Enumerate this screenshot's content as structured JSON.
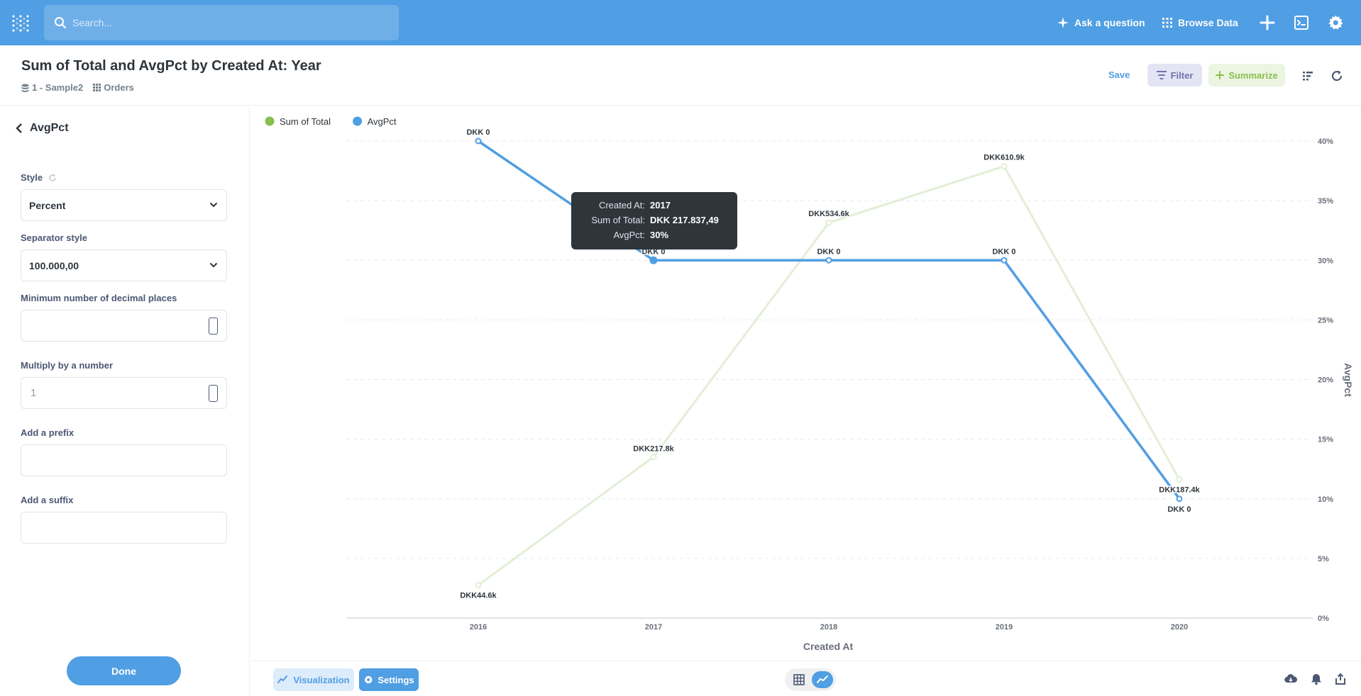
{
  "nav": {
    "search_placeholder": "Search...",
    "ask_label": "Ask a question",
    "browse_label": "Browse Data"
  },
  "header": {
    "title": "Sum of Total and AvgPct by Created At: Year",
    "database": "1 - Sample2",
    "table": "Orders",
    "save_label": "Save",
    "filter_label": "Filter",
    "summarize_label": "Summarize"
  },
  "sidebar": {
    "back_label": "AvgPct",
    "style_label": "Style",
    "style_value": "Percent",
    "separator_label": "Separator style",
    "separator_value": "100.000,00",
    "decimals_label": "Minimum number of decimal places",
    "decimals_value": "",
    "multiply_label": "Multiply by a number",
    "multiply_placeholder": "1",
    "prefix_label": "Add a prefix",
    "suffix_label": "Add a suffix",
    "done_label": "Done"
  },
  "tooltip": {
    "rows": [
      {
        "key": "Created At:",
        "value": "2017"
      },
      {
        "key": "Sum of Total:",
        "value": "DKK 217.837,49"
      },
      {
        "key": "AvgPct:",
        "value": "30%"
      }
    ]
  },
  "footer": {
    "visualization_label": "Visualization",
    "settings_label": "Settings"
  },
  "colors": {
    "brand": "#509ee3",
    "sum_of_total": "#88bf4d",
    "avgpct": "#509ee3"
  },
  "chart_data": {
    "type": "line",
    "categories": [
      "2016",
      "2017",
      "2018",
      "2019",
      "2020"
    ],
    "series": [
      {
        "name": "Sum of Total",
        "values": [
          44600,
          217800,
          534600,
          610900,
          187400
        ],
        "labels": [
          "DKK44.6k",
          "DKK217.8k",
          "DKK534.6k",
          "DKK610.9k",
          "DKK187.4k"
        ],
        "color": "#88bf4d",
        "dimmed": true
      },
      {
        "name": "AvgPct",
        "values": [
          40,
          30,
          30,
          30,
          10
        ],
        "labels": [
          "DKK 0",
          "DKK 0",
          "DKK 0",
          "DKK 0",
          "DKK 0"
        ],
        "color": "#509ee3"
      }
    ],
    "xlabel": "Created At",
    "ylabel_right": "AvgPct",
    "y_right_ticks": [
      "0%",
      "5%",
      "10%",
      "15%",
      "20%",
      "25%",
      "30%",
      "35%",
      "40%"
    ],
    "y_right_lim": [
      0,
      40
    ],
    "legend_position": "top-left",
    "grid": true
  }
}
